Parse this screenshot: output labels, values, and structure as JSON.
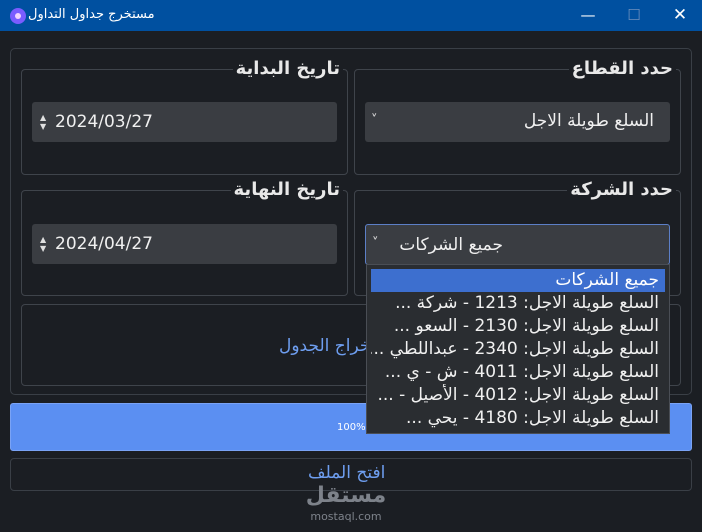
{
  "window": {
    "title": "مستخرج جداول التداول",
    "minimize_glyph": "—",
    "maximize_glyph": "☐",
    "close_glyph": "✕",
    "icon": "app-logo-icon"
  },
  "sector": {
    "title": "حدد القطاع",
    "selected": "السلع طويلة الاجل",
    "chevron": "˅"
  },
  "start_date": {
    "title": "تاريخ البداية",
    "value": "2024/03/27",
    "up": "▲",
    "down": "▼"
  },
  "company": {
    "title": "حدد الشركة",
    "selected": "جميع الشركات",
    "chevron": "˅",
    "options": [
      "جميع الشركات",
      "السلع طويلة الاجل: 1213 - شركة ...",
      "السلع طويلة الاجل: 2130 - السعو ...",
      "السلع طويلة الاجل: 2340 - عبداللطي ...",
      "السلع طويلة الاجل: 4011 - ش - ي ...",
      "السلع طويلة الاجل: 4012 - الأصيل - ...",
      "السلع طويلة الاجل: 4180 - يحي ..."
    ]
  },
  "end_date": {
    "title": "تاريخ النهاية",
    "value": "2024/04/27",
    "up": "▲",
    "down": "▼"
  },
  "extract_button": {
    "label": "استخراج الجدول"
  },
  "progress": {
    "value": 100,
    "text": "100%"
  },
  "open_file_button": {
    "label": "افتح الملف"
  },
  "watermark": {
    "main": "مستقل",
    "sub": "mostaql.com"
  },
  "colors": {
    "titlebar": "#0050a0",
    "background": "#1b1e23",
    "accent": "#5b8ff2",
    "link_text": "#6e9ef0",
    "selection": "#3d6fcf"
  }
}
